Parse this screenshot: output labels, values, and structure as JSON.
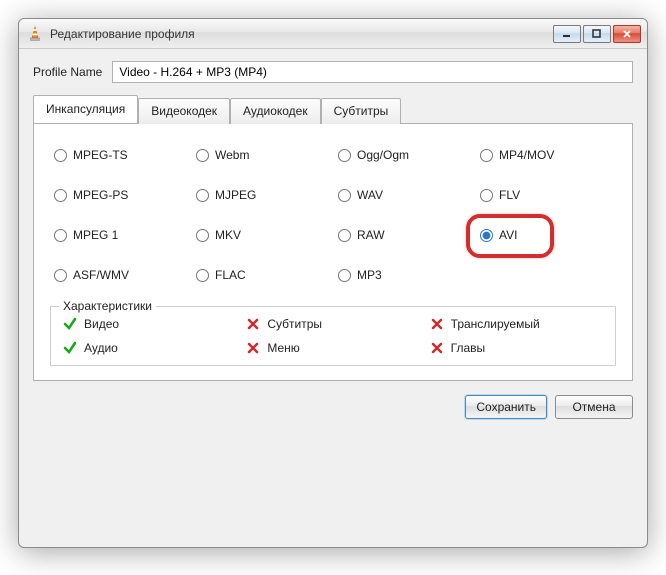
{
  "window": {
    "title": "Редактирование профиля"
  },
  "profile": {
    "label": "Profile Name",
    "value": "Video - H.264 + MP3 (MP4)"
  },
  "tabs": {
    "encapsulation": "Инкапсуляция",
    "video_codec": "Видеокодек",
    "audio_codec": "Аудиокодек",
    "subtitles": "Субтитры",
    "active": "encapsulation"
  },
  "formats": {
    "selected": "AVI",
    "items": [
      "MPEG-TS",
      "Webm",
      "Ogg/Ogm",
      "MP4/MOV",
      "MPEG-PS",
      "MJPEG",
      "WAV",
      "FLV",
      "MPEG 1",
      "MKV",
      "RAW",
      "AVI",
      "ASF/WMV",
      "FLAC",
      "MP3"
    ]
  },
  "features": {
    "title": "Характеристики",
    "video": {
      "label": "Видео",
      "ok": true
    },
    "audio": {
      "label": "Аудио",
      "ok": true
    },
    "subtitles": {
      "label": "Субтитры",
      "ok": false
    },
    "menu": {
      "label": "Меню",
      "ok": false
    },
    "streamable": {
      "label": "Транслируемый",
      "ok": false
    },
    "chapters": {
      "label": "Главы",
      "ok": false
    }
  },
  "buttons": {
    "save": "Сохранить",
    "cancel": "Отмена"
  }
}
